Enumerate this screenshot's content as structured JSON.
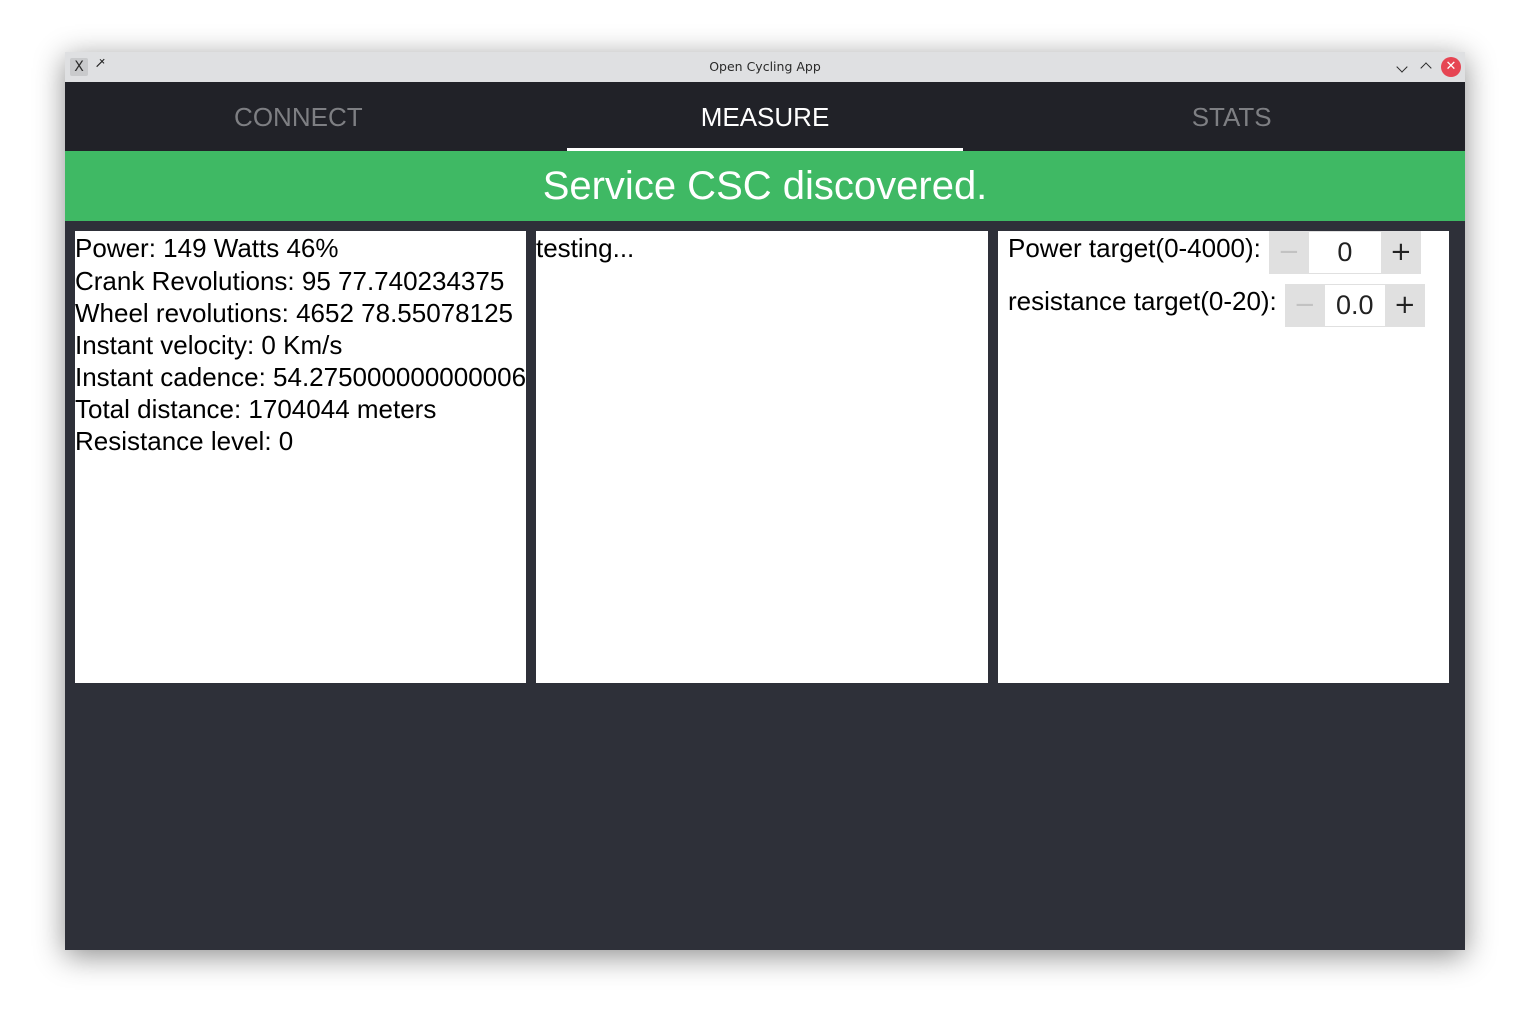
{
  "window": {
    "title": "Open Cycling App",
    "titlebar_icons": {
      "app": "x-app-icon",
      "pin": "pin-icon",
      "minimize": "chevron-down-icon",
      "maximize": "chevron-up-icon",
      "close": "close-icon"
    },
    "app_icon_glyph": "𝕏",
    "pin_glyph": "📌",
    "close_glyph": "✕"
  },
  "tabs": [
    {
      "label": "CONNECT",
      "active": false
    },
    {
      "label": "MEASURE",
      "active": true
    },
    {
      "label": "STATS",
      "active": false
    }
  ],
  "status_banner": {
    "text": "Service CSC discovered.",
    "color": "#3fb964"
  },
  "metrics": [
    "Power: 149 Watts 46%",
    "Crank Revolutions: 95 77.740234375",
    "Wheel revolutions: 4652 78.55078125",
    "Instant velocity: 0 Km/s",
    "Instant cadence: 54.275000000000006",
    "Total distance: 1704044 meters",
    "Resistance level: 0"
  ],
  "log": {
    "text": "testing..."
  },
  "targets": {
    "power": {
      "label": "Power target(0-4000):",
      "value": "0",
      "minus_label": "−",
      "plus_label": "+"
    },
    "resistance": {
      "label": "resistance target(0-20):",
      "value": "0.0",
      "minus_label": "−",
      "plus_label": "+"
    }
  },
  "colors": {
    "tab_bar_bg": "#212228",
    "content_bg": "#2e3039",
    "tab_inactive": "#7e7f83",
    "tab_active": "#ffffff"
  }
}
